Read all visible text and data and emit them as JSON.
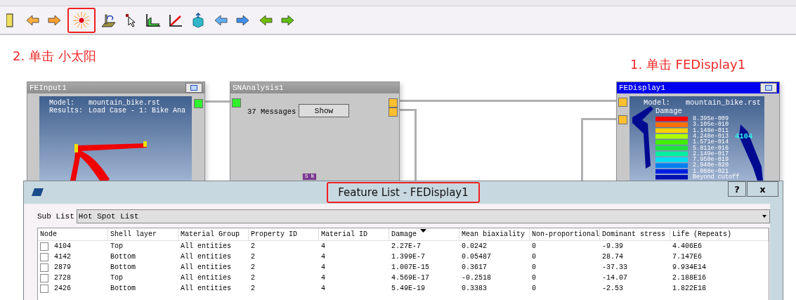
{
  "toolbar": {
    "tools": [
      {
        "highlighted": false
      },
      {
        "highlighted": false
      },
      {
        "highlighted": false
      },
      {
        "highlighted": true
      },
      {
        "highlighted": false
      },
      {
        "highlighted": false
      },
      {
        "highlighted": false
      },
      {
        "highlighted": false
      },
      {
        "highlighted": false
      },
      {
        "highlighted": false
      },
      {
        "highlighted": false
      },
      {
        "highlighted": false
      },
      {
        "highlighted": false
      }
    ]
  },
  "annotations": [
    {
      "text": "2. 单击 小太阳"
    },
    {
      "text": "1. 单击 FEDisplay1"
    }
  ],
  "nodes": [
    {
      "kind": "input",
      "title": "FEInput1",
      "active": false,
      "lines": [
        [
          "Model:",
          "mountain_bike.rst"
        ],
        [
          "Results:",
          "Load Case - 1: Bike Ana"
        ]
      ]
    },
    {
      "kind": "analysis",
      "title": "SNAnalysis1",
      "active": false,
      "messages": "37 Messages",
      "button": "Show",
      "badge": "S N"
    },
    {
      "kind": "display",
      "title": "FEDisplay1",
      "active": true,
      "lines": [
        [
          "Model:",
          "mountain_bike.rst"
        ]
      ],
      "legend_title": "Damage",
      "legend": [
        "8.395e-009",
        "3.105e-010",
        "1.148e-011",
        "4.248e-013",
        "1.571e-014",
        "5.811e-016",
        "2.149e-017",
        "7.950e-019",
        "2.940e-020",
        "1.088e-021",
        "Beyond cutoff"
      ],
      "probe": "4104"
    }
  ],
  "dialog": {
    "title": "Feature List - FEDisplay1",
    "help": "?",
    "close": "x",
    "sub_list_label": "Sub List",
    "sub_list_value": "Hot Spot List",
    "columns": [
      {
        "label": "Node",
        "sorted": false
      },
      {
        "label": "Shell layer",
        "sorted": false
      },
      {
        "label": "Material Group",
        "sorted": false
      },
      {
        "label": "Property ID",
        "sorted": false
      },
      {
        "label": "Material ID",
        "sorted": false
      },
      {
        "label": "Damage",
        "sorted": true
      },
      {
        "label": "Mean biaxiality",
        "sorted": false
      },
      {
        "label": "Non-proportional",
        "sorted": false
      },
      {
        "label": "Dominant stress",
        "sorted": false
      },
      {
        "label": "Life (Repeats)",
        "sorted": false
      }
    ],
    "rows": [
      {
        "checked": false,
        "cells": [
          "4104",
          "Top",
          "All entities",
          "2",
          "4",
          "2.27E-7",
          "0.0242",
          "0",
          "-9.39",
          "4.406E6"
        ]
      },
      {
        "checked": false,
        "cells": [
          "4142",
          "Bottom",
          "All entities",
          "2",
          "4",
          "1.399E-7",
          "0.05487",
          "0",
          "28.74",
          "7.147E6"
        ]
      },
      {
        "checked": false,
        "cells": [
          "2879",
          "Bottom",
          "All entities",
          "2",
          "4",
          "1.007E-15",
          "0.3617",
          "0",
          "-37.33",
          "9.934E14"
        ]
      },
      {
        "checked": false,
        "cells": [
          "2728",
          "Top",
          "All entities",
          "2",
          "4",
          "4.569E-17",
          "-0.2518",
          "0",
          "-14.07",
          "2.188E16"
        ]
      },
      {
        "checked": false,
        "cells": [
          "2426",
          "Bottom",
          "All entities",
          "2",
          "4",
          "5.49E-19",
          "0.3383",
          "0",
          "-2.53",
          "1.822E18"
        ]
      }
    ]
  }
}
